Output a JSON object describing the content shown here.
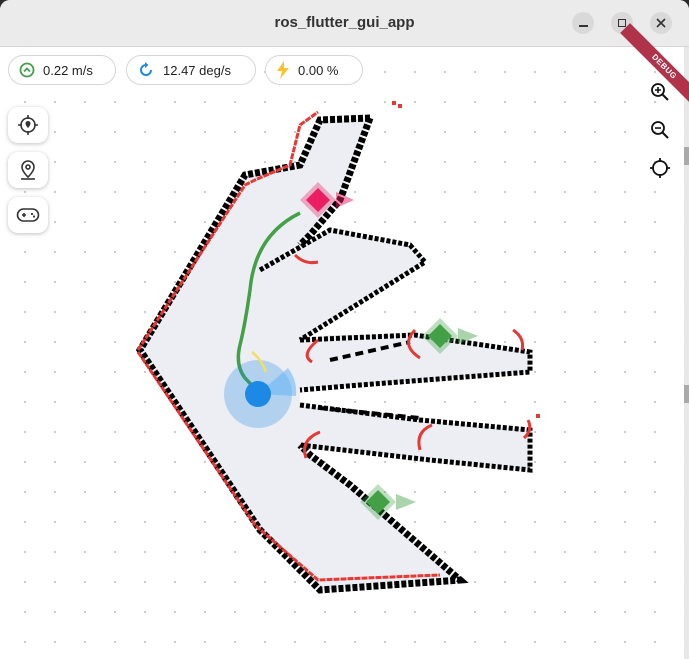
{
  "window": {
    "title": "ros_flutter_gui_app",
    "minimize_icon": "minimize-icon",
    "maximize_icon": "maximize-icon",
    "close_icon": "close-icon"
  },
  "status": {
    "linear_speed": "0.22 m/s",
    "angular_speed": "12.47 deg/s",
    "battery": "0.00 %"
  },
  "debug_banner": "DEBUG",
  "tools": [
    "relocalize-icon",
    "navigation-goal-icon",
    "gamepad-icon"
  ],
  "zoom_controls": [
    "zoom-in-icon",
    "zoom-out-icon",
    "center-robot-icon"
  ],
  "colors": {
    "laser": "#e53935",
    "path": "#43a047",
    "robot": "#1e88e5",
    "goal_active": "#e91e63",
    "goal_waypoint": "#43a047",
    "map_free": "#eceef3",
    "map_wall": "#000000"
  }
}
